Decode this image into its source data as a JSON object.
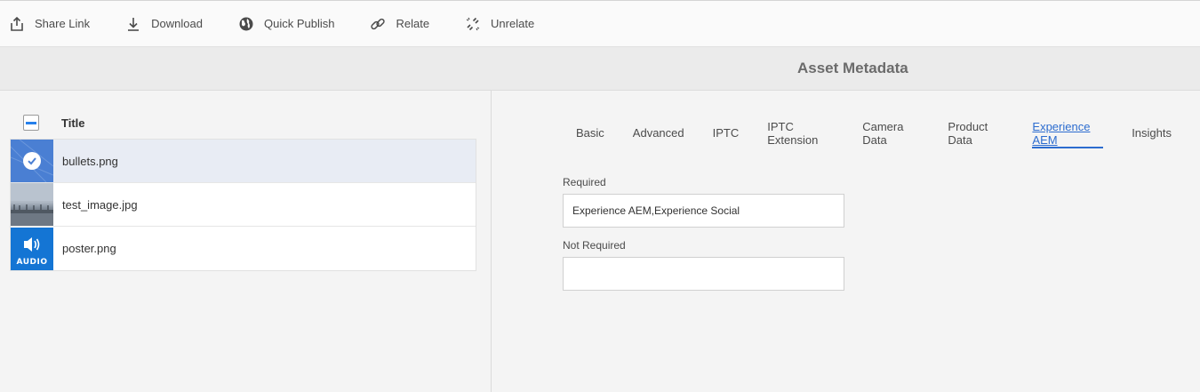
{
  "toolbar": {
    "items": [
      {
        "label": "Share Link",
        "icon": "share-icon"
      },
      {
        "label": "Download",
        "icon": "download-icon"
      },
      {
        "label": "Quick Publish",
        "icon": "globe-icon"
      },
      {
        "label": "Relate",
        "icon": "link-icon"
      },
      {
        "label": "Unrelate",
        "icon": "unlink-icon"
      }
    ]
  },
  "title_bar": {
    "title": "Asset Metadata"
  },
  "asset_list": {
    "header": {
      "title": "Title"
    },
    "rows": [
      {
        "name": "bullets.png",
        "selected": true,
        "thumb": "selected-check"
      },
      {
        "name": "test_image.jpg",
        "selected": false,
        "thumb": "image"
      },
      {
        "name": "poster.png",
        "selected": false,
        "thumb": "audio",
        "thumb_label": "AUDIO"
      }
    ]
  },
  "metadata": {
    "tabs": [
      {
        "label": "Basic",
        "active": false
      },
      {
        "label": "Advanced",
        "active": false
      },
      {
        "label": "IPTC",
        "active": false
      },
      {
        "label": "IPTC Extension",
        "active": false
      },
      {
        "label": "Camera Data",
        "active": false
      },
      {
        "label": "Product Data",
        "active": false
      },
      {
        "label": "Experience AEM",
        "active": true
      },
      {
        "label": "Insights",
        "active": false
      }
    ],
    "fields": {
      "required": {
        "label": "Required",
        "value": "Experience AEM,Experience Social"
      },
      "not_required": {
        "label": "Not Required",
        "value": ""
      }
    }
  },
  "colors": {
    "accent": "#2c6ccf",
    "selected_row": "#e8ecf4",
    "audio_thumb": "#1475d4"
  }
}
